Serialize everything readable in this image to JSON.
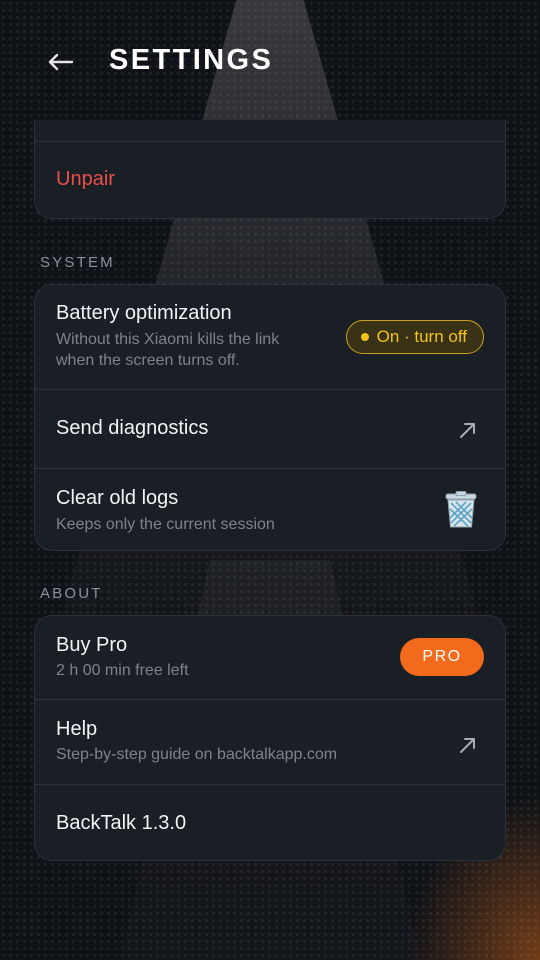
{
  "header": {
    "title": "SETTINGS",
    "back_icon": "arrow-left-icon"
  },
  "pairing": {
    "unpair_label": "Unpair",
    "unpair_color": "#e8504a"
  },
  "system": {
    "section_label": "SYSTEM",
    "battery": {
      "title": "Battery optimization",
      "subtitle_line1": "Without this Xiaomi kills the link",
      "subtitle_line2": "when the screen turns off.",
      "toggle_label": "On · turn off",
      "toggle_color": "#f0c419"
    },
    "diagnostics": {
      "title": "Send diagnostics",
      "icon": "external-arrow-icon"
    },
    "logs": {
      "title": "Clear old logs",
      "subtitle": "Keeps only the current session",
      "icon": "trash-icon"
    }
  },
  "about": {
    "section_label": "ABOUT",
    "buy_pro": {
      "title": "Buy Pro",
      "subtitle": "2 h 00 min free left",
      "badge": "PRO",
      "badge_color": "#f26a1b"
    },
    "help": {
      "title": "Help",
      "subtitle": "Step-by-step guide on backtalkapp.com",
      "icon": "external-arrow-icon"
    },
    "version": {
      "title": "BackTalk 1.3.0"
    }
  }
}
